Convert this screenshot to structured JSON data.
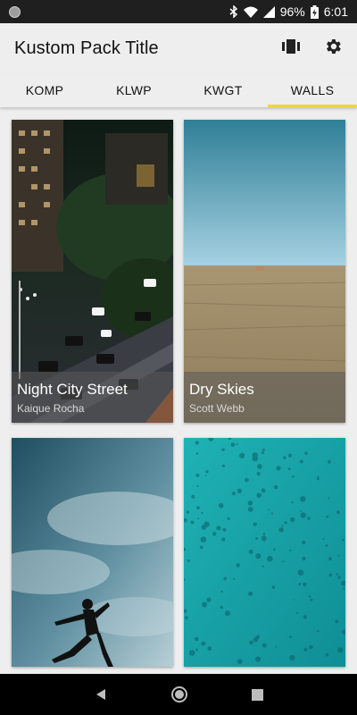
{
  "status_bar": {
    "battery": "96%",
    "time": "6:01",
    "icons": [
      "bluetooth-icon",
      "wifi-icon",
      "signal-icon",
      "battery-charging-icon"
    ]
  },
  "app_bar": {
    "title": "Kustom Pack Title",
    "actions": [
      "wallpaper-icon",
      "gear-icon"
    ]
  },
  "tabs": [
    {
      "label": "KOMP",
      "active": false
    },
    {
      "label": "KLWP",
      "active": false
    },
    {
      "label": "KWGT",
      "active": false
    },
    {
      "label": "WALLS",
      "active": true
    }
  ],
  "tab_indicator_color": "#f2d637",
  "walls": [
    {
      "title": "Night City Street",
      "author": "Kaique Rocha"
    },
    {
      "title": "Dry Skies",
      "author": "Scott Webb"
    },
    {
      "title": "",
      "author": ""
    },
    {
      "title": "",
      "author": ""
    }
  ],
  "nav_bar": {
    "buttons": [
      "back-icon",
      "home-icon",
      "recents-icon"
    ]
  }
}
